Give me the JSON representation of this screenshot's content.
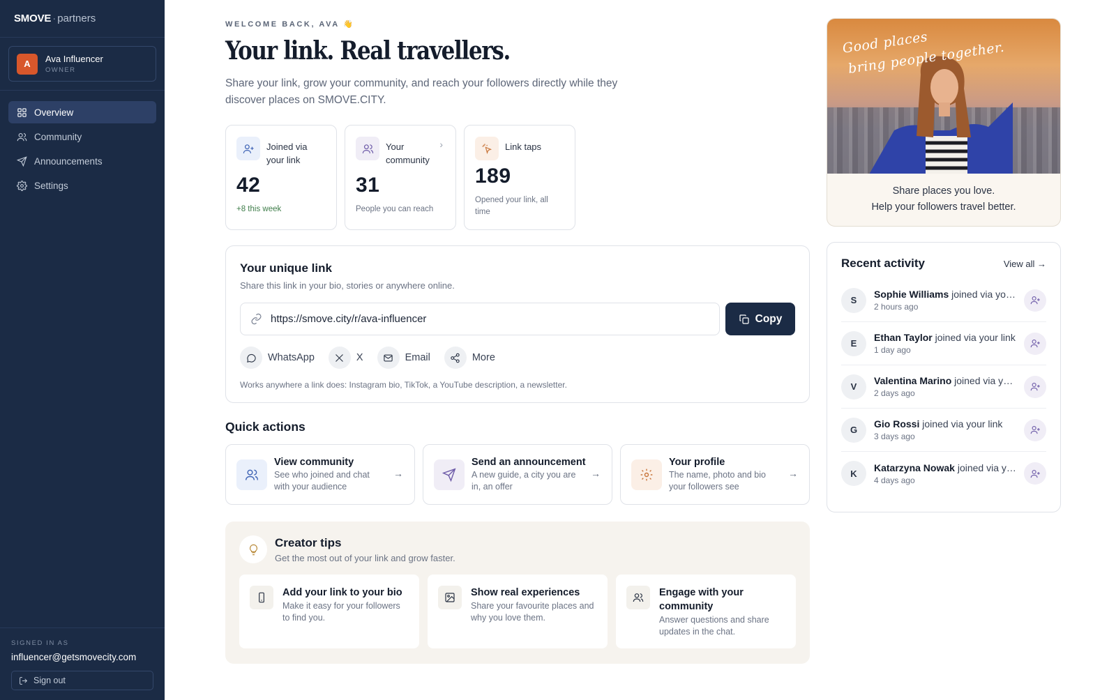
{
  "brand": {
    "name": "SMOVE",
    "separator": "·",
    "suffix": "partners"
  },
  "account": {
    "initial": "A",
    "name": "Ava Influencer",
    "role": "OWNER"
  },
  "nav": [
    {
      "label": "Overview",
      "icon": "grid-icon",
      "active": true
    },
    {
      "label": "Community",
      "icon": "users-icon"
    },
    {
      "label": "Announcements",
      "icon": "send-icon"
    },
    {
      "label": "Settings",
      "icon": "gear-icon"
    }
  ],
  "footer": {
    "signed_label": "SIGNED IN AS",
    "email": "influencer@getsmovecity.com",
    "signout": "Sign out"
  },
  "hero": {
    "welcome": "WELCOME BACK, AVA 👋",
    "title": "Your link. Real travellers.",
    "subtitle": "Share your link, grow your community, and reach your followers directly while they discover places on SMOVE.CITY."
  },
  "stats": [
    {
      "label": "Joined via your link",
      "value": "42",
      "note": "+8 this week",
      "icon": "user-plus-icon"
    },
    {
      "label": "Your community",
      "value": "31",
      "note": "People you can reach",
      "icon": "users-icon"
    },
    {
      "label": "Link taps",
      "value": "189",
      "note": "Opened your link, all time",
      "icon": "sparkle-icon"
    }
  ],
  "link": {
    "title": "Your unique link",
    "subtitle": "Share this link in your bio, stories or anywhere online.",
    "url": "https://smove.city/r/ava-influencer",
    "copy": "Copy",
    "share": [
      "WhatsApp",
      "X",
      "Email",
      "More"
    ],
    "footnote": "Works anywhere a link does: Instagram bio, TikTok, a YouTube description, a newsletter."
  },
  "quick_actions": {
    "title": "Quick actions",
    "items": [
      {
        "name": "View community",
        "desc": "See who joined and chat with your audience",
        "icon": "users-icon"
      },
      {
        "name": "Send an announcement",
        "desc": "A new guide, a city you are in, an offer",
        "icon": "send-icon"
      },
      {
        "name": "Your profile",
        "desc": "The name, photo and bio your followers see",
        "icon": "gear-icon"
      }
    ]
  },
  "tips": {
    "title": "Creator tips",
    "subtitle": "Get the most out of your link and grow faster.",
    "items": [
      {
        "name": "Add your link to your bio",
        "desc": "Make it easy for your followers to find you.",
        "icon": "phone-icon"
      },
      {
        "name": "Show real experiences",
        "desc": "Share your favourite places and why you love them.",
        "icon": "image-icon"
      },
      {
        "name": "Engage with your community",
        "desc": "Answer questions and share updates in the chat.",
        "icon": "users-icon"
      }
    ]
  },
  "promo": {
    "script_line1": "Good places",
    "script_line2": "bring people together.",
    "line1": "Share places you love.",
    "line2": "Help your followers travel better."
  },
  "activity": {
    "title": "Recent activity",
    "view_all": "View all →",
    "items": [
      {
        "initial": "S",
        "name": "Sophie Williams",
        "action": " joined via your link",
        "time": "2 hours ago"
      },
      {
        "initial": "E",
        "name": "Ethan Taylor",
        "action": " joined via your link",
        "time": "1 day ago"
      },
      {
        "initial": "V",
        "name": "Valentina Marino",
        "action": " joined via your link",
        "time": "2 days ago"
      },
      {
        "initial": "G",
        "name": "Gio Rossi",
        "action": " joined via your link",
        "time": "3 days ago"
      },
      {
        "initial": "K",
        "name": "Katarzyna Nowak",
        "action": " joined via your link",
        "time": "4 days ago"
      }
    ]
  }
}
